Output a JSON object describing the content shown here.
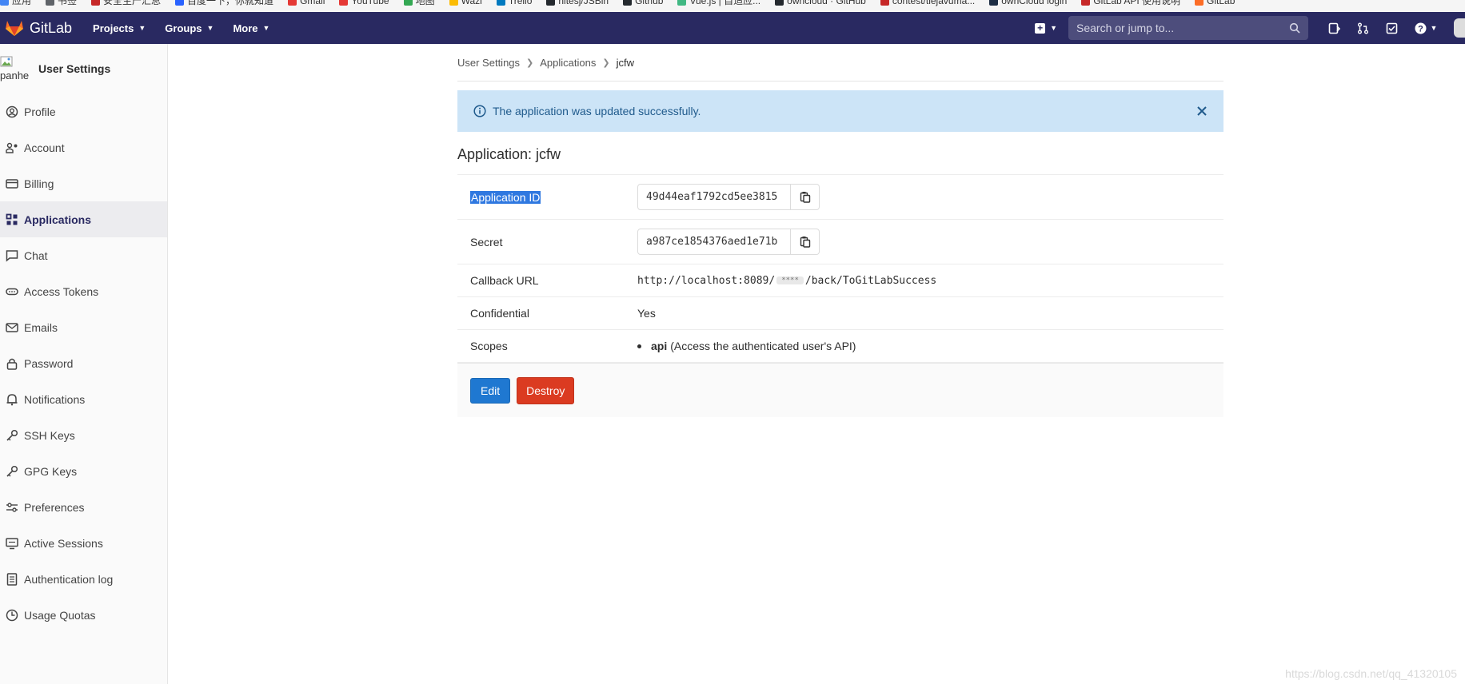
{
  "bookmarks": [
    {
      "label": "应用",
      "color": "#4285f4"
    },
    {
      "label": "书签",
      "color": "#5f6368"
    },
    {
      "label": "安全生产汇总",
      "color": "#c62828"
    },
    {
      "label": "百度一下，你就知道",
      "color": "#2962ff"
    },
    {
      "label": "Gmail",
      "color": "#e53935"
    },
    {
      "label": "YouTube",
      "color": "#e53935"
    },
    {
      "label": "地图",
      "color": "#34a853"
    },
    {
      "label": "Wazi",
      "color": "#fbbc05"
    },
    {
      "label": "Trello",
      "color": "#0079bf"
    },
    {
      "label": "nitesj/JSBin",
      "color": "#24292e"
    },
    {
      "label": "Github",
      "color": "#24292e"
    },
    {
      "label": "Vue.js | 自适应...",
      "color": "#41b883"
    },
    {
      "label": "owncloud · GitHub",
      "color": "#24292e"
    },
    {
      "label": "contest/tiejavuma...",
      "color": "#c62828"
    },
    {
      "label": "ownCloud login",
      "color": "#1d2d44"
    },
    {
      "label": "GitLab API 使用说明",
      "color": "#c62828"
    },
    {
      "label": "GitLab",
      "color": "#fc6d26"
    }
  ],
  "navbar": {
    "brand": "GitLab",
    "menu": [
      "Projects",
      "Groups",
      "More"
    ],
    "search_placeholder": "Search or jump to..."
  },
  "sidebar": {
    "avatar_text": "panhe",
    "title": "User Settings",
    "items": [
      {
        "label": "Profile",
        "icon": "profile-icon",
        "active": false
      },
      {
        "label": "Account",
        "icon": "account-icon",
        "active": false
      },
      {
        "label": "Billing",
        "icon": "billing-icon",
        "active": false
      },
      {
        "label": "Applications",
        "icon": "applications-icon",
        "active": true
      },
      {
        "label": "Chat",
        "icon": "chat-icon",
        "active": false
      },
      {
        "label": "Access Tokens",
        "icon": "token-icon",
        "active": false
      },
      {
        "label": "Emails",
        "icon": "email-icon",
        "active": false
      },
      {
        "label": "Password",
        "icon": "lock-icon",
        "active": false
      },
      {
        "label": "Notifications",
        "icon": "bell-icon",
        "active": false
      },
      {
        "label": "SSH Keys",
        "icon": "key-icon",
        "active": false
      },
      {
        "label": "GPG Keys",
        "icon": "key-icon",
        "active": false
      },
      {
        "label": "Preferences",
        "icon": "preferences-icon",
        "active": false
      },
      {
        "label": "Active Sessions",
        "icon": "monitor-icon",
        "active": false
      },
      {
        "label": "Authentication log",
        "icon": "log-icon",
        "active": false
      },
      {
        "label": "Usage Quotas",
        "icon": "quota-icon",
        "active": false
      }
    ]
  },
  "breadcrumb": [
    "User Settings",
    "Applications",
    "jcfw"
  ],
  "alert": {
    "message": "The application was updated successfully."
  },
  "page_title": "Application: jcfw",
  "details": {
    "application_id_label": "Application ID",
    "application_id": "49d44eaf1792cd5ee3815",
    "secret_label": "Secret",
    "secret": "a987ce1854376aed1e71b",
    "callback_label": "Callback URL",
    "callback_prefix": "http://localhost:8089/",
    "callback_mask": "****",
    "callback_suffix": "/back/ToGitLabSuccess",
    "confidential_label": "Confidential",
    "confidential": "Yes",
    "scopes_label": "Scopes",
    "scope_name": "api",
    "scope_desc": "(Access the authenticated user's API)"
  },
  "actions": {
    "edit": "Edit",
    "destroy": "Destroy"
  },
  "watermark": "https://blog.csdn.net/qq_41320105",
  "colors": {
    "navbar": "#292961",
    "alert_bg": "#cce4f7",
    "edit": "#1f78d1",
    "destroy": "#db3b21"
  }
}
